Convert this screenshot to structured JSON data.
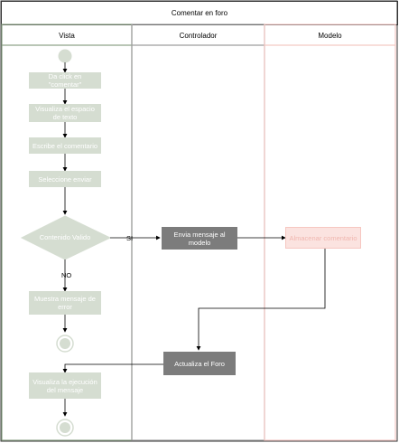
{
  "title": "Comentar en foro",
  "lanes": {
    "vista": "Vista",
    "controlador": "Controlador",
    "modelo": "Modelo"
  },
  "nodes": {
    "click_comentar": "Da click en \"comentar\"",
    "visualiza_espacio": "Visualiza el espacio de texto",
    "escribe_comentario": "Escribe el comentario",
    "selecciona_enviar": "Seleccione enviar",
    "contenido_valido": "Contenido Valido",
    "envia_mensaje": "Envia mensaje al modelo",
    "almacenar_comentario": "Almacenar comentario",
    "muestra_error": "Muestra mensaje de error",
    "actualiza_foro": "Actualiza el Foro",
    "visualiza_ejecucion": "Visualiza la ejecución del mensaje"
  },
  "edge_labels": {
    "si": "SI",
    "no": "NO"
  },
  "colors": {
    "vista_lane": "#8fa58a",
    "controlador_lane": "#9e9e9e",
    "modelo_lane": "#f4c9c4",
    "vista_fill": "#d5ddd1",
    "controlador_fill": "#7c7c7c",
    "modelo_fill": "#fbe3e0"
  }
}
